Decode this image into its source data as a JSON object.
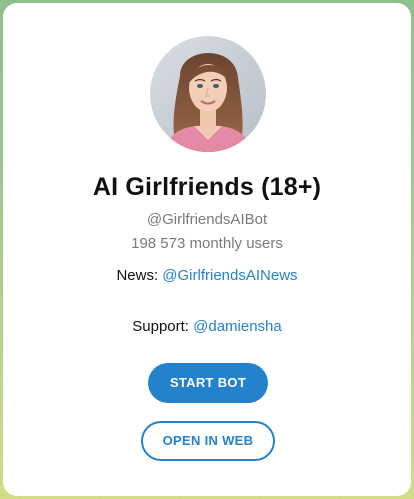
{
  "bot": {
    "title": "AI Girlfriends (18+)",
    "username": "@GirlfriendsAIBot",
    "monthly_users": "198 573 monthly users"
  },
  "news": {
    "label": "News:",
    "link_text": "@GirlfriendsAINews"
  },
  "support": {
    "label": "Support:",
    "link_text": "@damiensha"
  },
  "buttons": {
    "start_label": "START BOT",
    "web_label": "OPEN IN WEB"
  },
  "colors": {
    "accent": "#2481cc",
    "title_text": "#111111",
    "muted_text": "#7a7a7a",
    "card_bg": "#ffffff"
  },
  "icons": {
    "avatar": "profile-photo"
  }
}
